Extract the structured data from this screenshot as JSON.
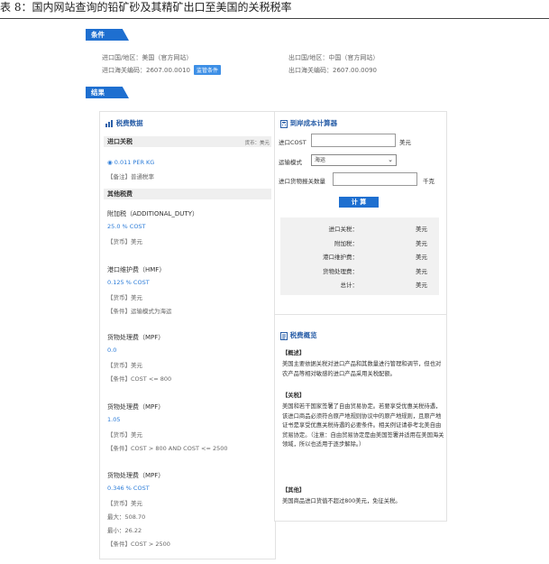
{
  "caption": "表 8：国内网站查询的铅矿砂及其精矿出口至美国的关税税率",
  "tags": {
    "conditions": "条件",
    "results": "结果"
  },
  "conditions": {
    "import_country": "进口国/地区：美国（官方网站）",
    "import_hs": "进口海关编码：2607.00.0010",
    "monitor_badge": "监管条件",
    "export_country": "出口国/地区：中国（官方网站）",
    "export_hs": "出口海关编码：2607.00.0090"
  },
  "tax": {
    "title": "税费数据",
    "import_duty_label": "进口关税",
    "currency_note": "货币：美元",
    "rate": "0.011 PER KG",
    "remark": "【备注】普通税率",
    "other_label": "其他税费",
    "items": [
      {
        "title": "附加税（ADDITIONAL_DUTY）",
        "rate": "25.0 % COST",
        "lines": [
          "【货币】美元"
        ]
      },
      {
        "title": "港口维护费（HMF）",
        "rate": "0.125 % COST",
        "lines": [
          "【货币】美元",
          "【条件】运输模式为海运"
        ]
      },
      {
        "title": "货物处理费（MPF）",
        "rate": "0.0",
        "lines": [
          "【货币】美元",
          "【条件】COST <= 800"
        ]
      },
      {
        "title": "货物处理费（MPF）",
        "rate": "1.05",
        "lines": [
          "【货币】美元",
          "【条件】COST > 800 AND COST <= 2500"
        ]
      },
      {
        "title": "货物处理费（MPF）",
        "rate": "0.346 % COST",
        "lines": [
          "【货币】美元",
          "最大：508.70",
          "最小：26.22",
          "【条件】COST > 2500"
        ]
      }
    ]
  },
  "calculator": {
    "title": "到岸成本计算器",
    "cost_label": "进口COST",
    "cost_unit": "美元",
    "transport_label": "运输模式",
    "transport_value": "海运",
    "qty_label": "进口货物报关数量",
    "qty_unit": "千克",
    "calc_button": "计 算",
    "results": [
      {
        "k": "进口关税：",
        "v": "美元"
      },
      {
        "k": "附加税：",
        "v": "美元"
      },
      {
        "k": "港口维护费：",
        "v": "美元"
      },
      {
        "k": "货物处理费：",
        "v": "美元"
      },
      {
        "k": "总计：",
        "v": "美元"
      }
    ]
  },
  "overview": {
    "title": "税费概览",
    "sections": [
      {
        "head": "【概述】",
        "body": "美国主要依据关税对进口产品和其数量进行管理和调节，但也对农产品等相对敏感的进口产品采用关税配额。"
      },
      {
        "head": "【关税】",
        "body": "美国和若干国家签署了自由贸易协定。若要享受优惠关税待遇，该进口商品必须符合原产地规则协议中的原产地规则，且原产地证书是享受优惠关税待遇的必要条件。相关例证请参考北美自由贸易协定。（注意：自由贸易协定是由美国签署并适用在美国海关领域，所以也适用于逐步解除。）"
      },
      {
        "head": "【其他】",
        "body": "美国商品进口货值不超过800美元，免征关税。"
      }
    ]
  },
  "colors": {
    "accent": "#1e6fd0",
    "link": "#2a7bd8"
  }
}
